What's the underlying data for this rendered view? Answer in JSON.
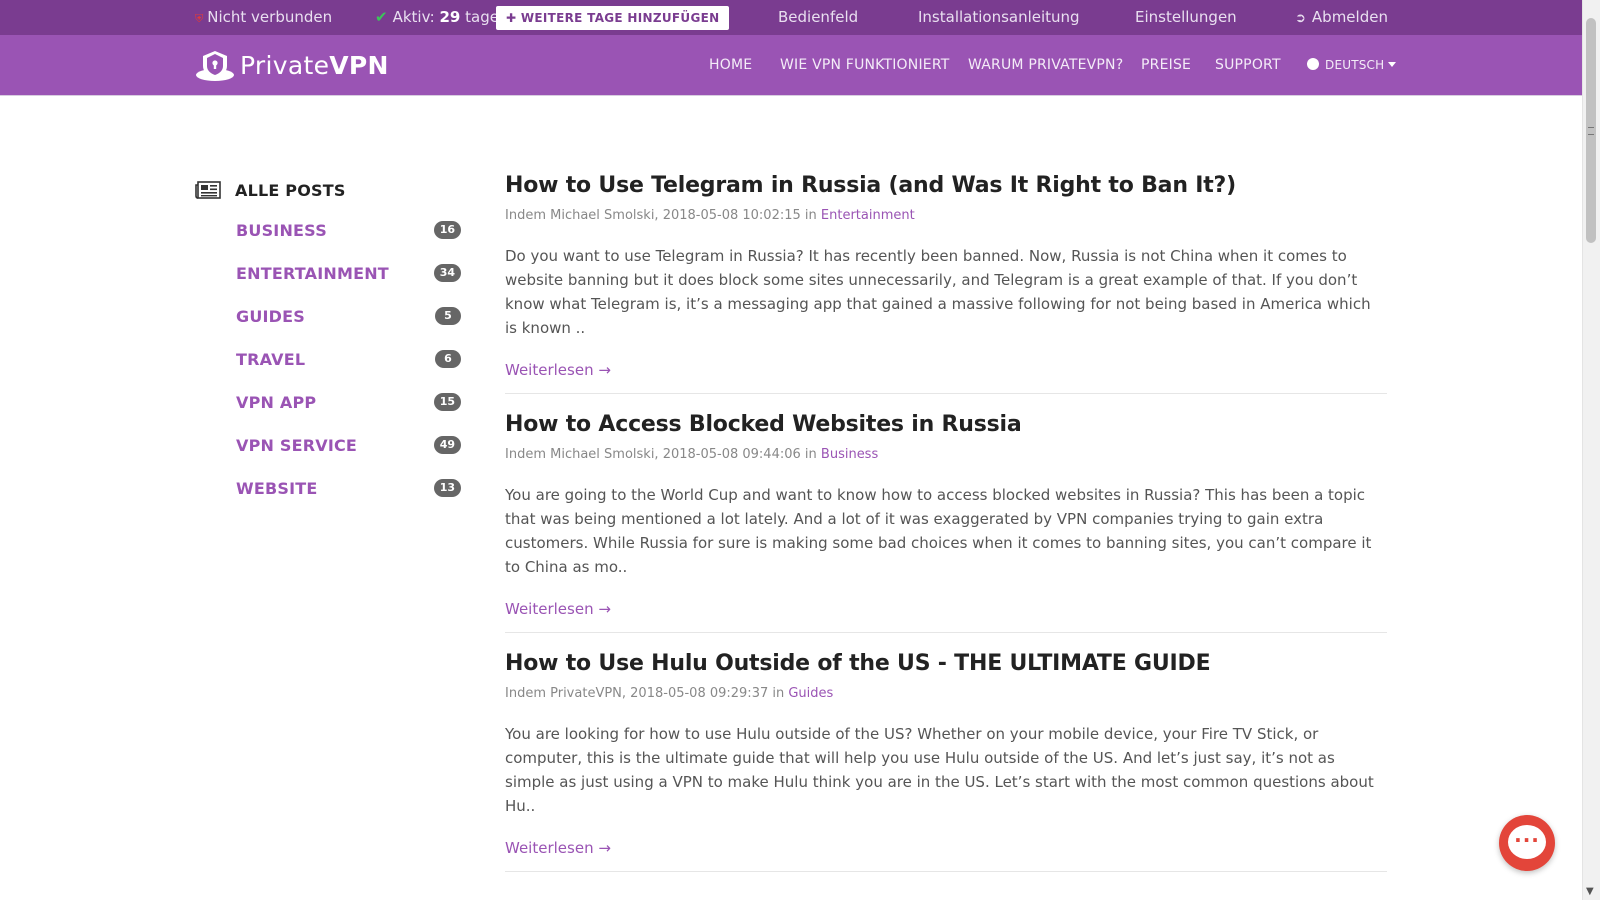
{
  "topbar": {
    "status": "Nicht verbunden",
    "active_prefix": "Aktiv:",
    "active_days": "29",
    "active_suffix": "tage",
    "add_days_label": "WEITERE TAGE HINZUFÜGEN",
    "links": [
      "Bedienfeld",
      "Installationsanleitung",
      "Einstellungen"
    ],
    "logout": "Abmelden"
  },
  "nav": {
    "brand_light": "Private",
    "brand_bold": "VPN",
    "items": [
      "HOME",
      "WIE VPN FUNKTIONIERT",
      "WARUM PRIVATEVPN?",
      "PREISE",
      "SUPPORT"
    ],
    "language": "DEUTSCH"
  },
  "sidebar": {
    "all_posts": "ALLE POSTS",
    "categories": [
      {
        "label": "BUSINESS",
        "count": "16"
      },
      {
        "label": "ENTERTAINMENT",
        "count": "34"
      },
      {
        "label": "GUIDES",
        "count": "5"
      },
      {
        "label": "TRAVEL",
        "count": "6"
      },
      {
        "label": "VPN APP",
        "count": "15"
      },
      {
        "label": "VPN SERVICE",
        "count": "49"
      },
      {
        "label": "WEBSITE",
        "count": "13"
      }
    ]
  },
  "posts": [
    {
      "title": "How to Use Telegram in Russia (and Was It Right to Ban It?)",
      "meta_prefix": "Indem Michael Smolski, 2018-05-08 10:02:15 in",
      "category": "Entertainment",
      "excerpt": "Do you want to use Telegram in Russia? It has recently been banned. Now, Russia is not China when it comes to website banning but it does block some sites unnecessarily, and Telegram is a great example of that. If you don’t know what Telegram is, it’s a messaging app that gained a massive following for not being based in America which is known ..",
      "read_more": "Weiterlesen →"
    },
    {
      "title": "How to Access Blocked Websites in Russia",
      "meta_prefix": "Indem Michael Smolski, 2018-05-08 09:44:06 in",
      "category": "Business",
      "excerpt": "You are going to the World Cup and want to know how to access blocked websites in Russia? This has been a topic that was being mentioned a lot lately. And a lot of it was exaggerated by VPN companies trying to gain extra customers. While Russia for sure is making some bad choices when it comes to banning sites, you can’t compare it to China as mo..",
      "read_more": "Weiterlesen →"
    },
    {
      "title": "How to Use Hulu Outside of the US - THE ULTIMATE GUIDE",
      "meta_prefix": "Indem PrivateVPN, 2018-05-08 09:29:37 in",
      "category": "Guides",
      "excerpt": "You are looking for how to use Hulu outside of the US? Whether on your mobile device, your Fire TV Stick, or computer, this is the ultimate guide that will help you use Hulu outside of the US. And let’s just say, it’s not as simple as just using a VPN to make Hulu think you are in the US. Let’s start with the most common questions about Hu..",
      "read_more": "Weiterlesen →"
    }
  ],
  "chat": {
    "icon": "chat-bubble-icon"
  },
  "colors": {
    "topbar": "#7a3c90",
    "navbar": "#9a54b4",
    "accent": "#9a54b4",
    "chat": "#e3453a"
  }
}
